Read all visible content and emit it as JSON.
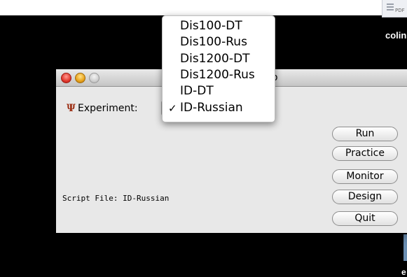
{
  "window": {
    "title": "ab"
  },
  "experiment": {
    "label": "Experiment:",
    "icon": "psi-icon",
    "selected": "ID-Russian",
    "options": [
      "Dis100-DT",
      "Dis100-Rus",
      "Dis1200-DT",
      "Dis1200-Rus",
      "ID-DT",
      "ID-Russian"
    ]
  },
  "menu": {
    "check_mark": "✓"
  },
  "script_file": "Script File: ID-Russian",
  "buttons": {
    "run": "Run",
    "practice": "Practice",
    "monitor": "Monitor",
    "design": "Design",
    "quit": "Quit"
  },
  "desktop": {
    "pdf_icon_text": "PDF",
    "label_1": "colin",
    "label_2": "e"
  },
  "colors": {
    "desktop_background": "#000000",
    "window_background": "#e8e8e8",
    "close_button": "#e2382d",
    "minimize_button": "#e8a21b",
    "icon_color": "#9a2b10"
  }
}
